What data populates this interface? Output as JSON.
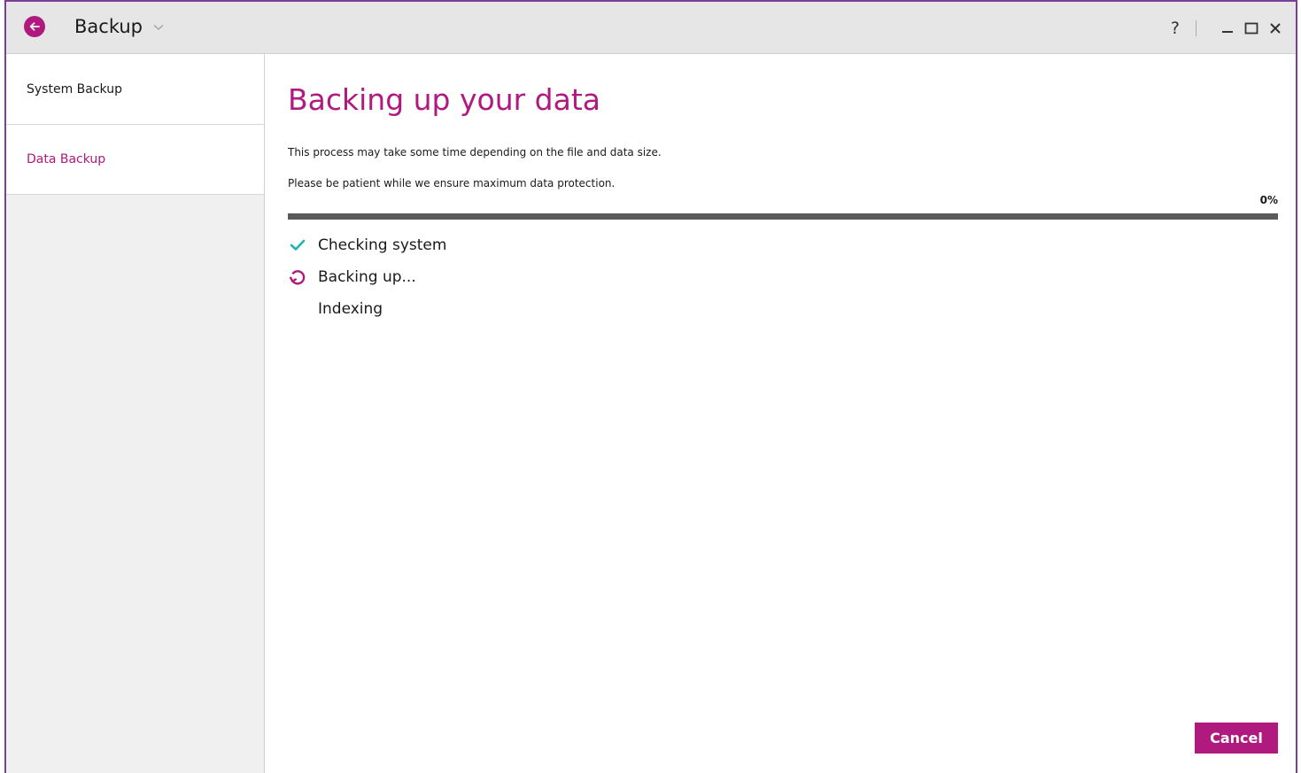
{
  "titlebar": {
    "title": "Backup",
    "help": "?"
  },
  "sidebar": {
    "items": [
      {
        "label": "System Backup",
        "active": false
      },
      {
        "label": "Data Backup",
        "active": true
      }
    ]
  },
  "main": {
    "heading": "Backing up your data",
    "paragraphs": [
      "This process may take some time depending on the file and data size.",
      "Please be patient while we ensure maximum data protection."
    ],
    "progress_percent_label": "0%",
    "progress_value": 0,
    "steps": [
      {
        "label": "Checking system",
        "status": "done",
        "icon": "checkmark-icon"
      },
      {
        "label": "Backing up...",
        "status": "in-progress",
        "icon": "refresh-icon"
      },
      {
        "label": "Indexing",
        "status": "pending",
        "icon": ""
      }
    ],
    "cancel_label": "Cancel"
  },
  "colors": {
    "accent": "#b0197e",
    "check": "#1fb5ad",
    "window_border": "#7b3f98"
  }
}
